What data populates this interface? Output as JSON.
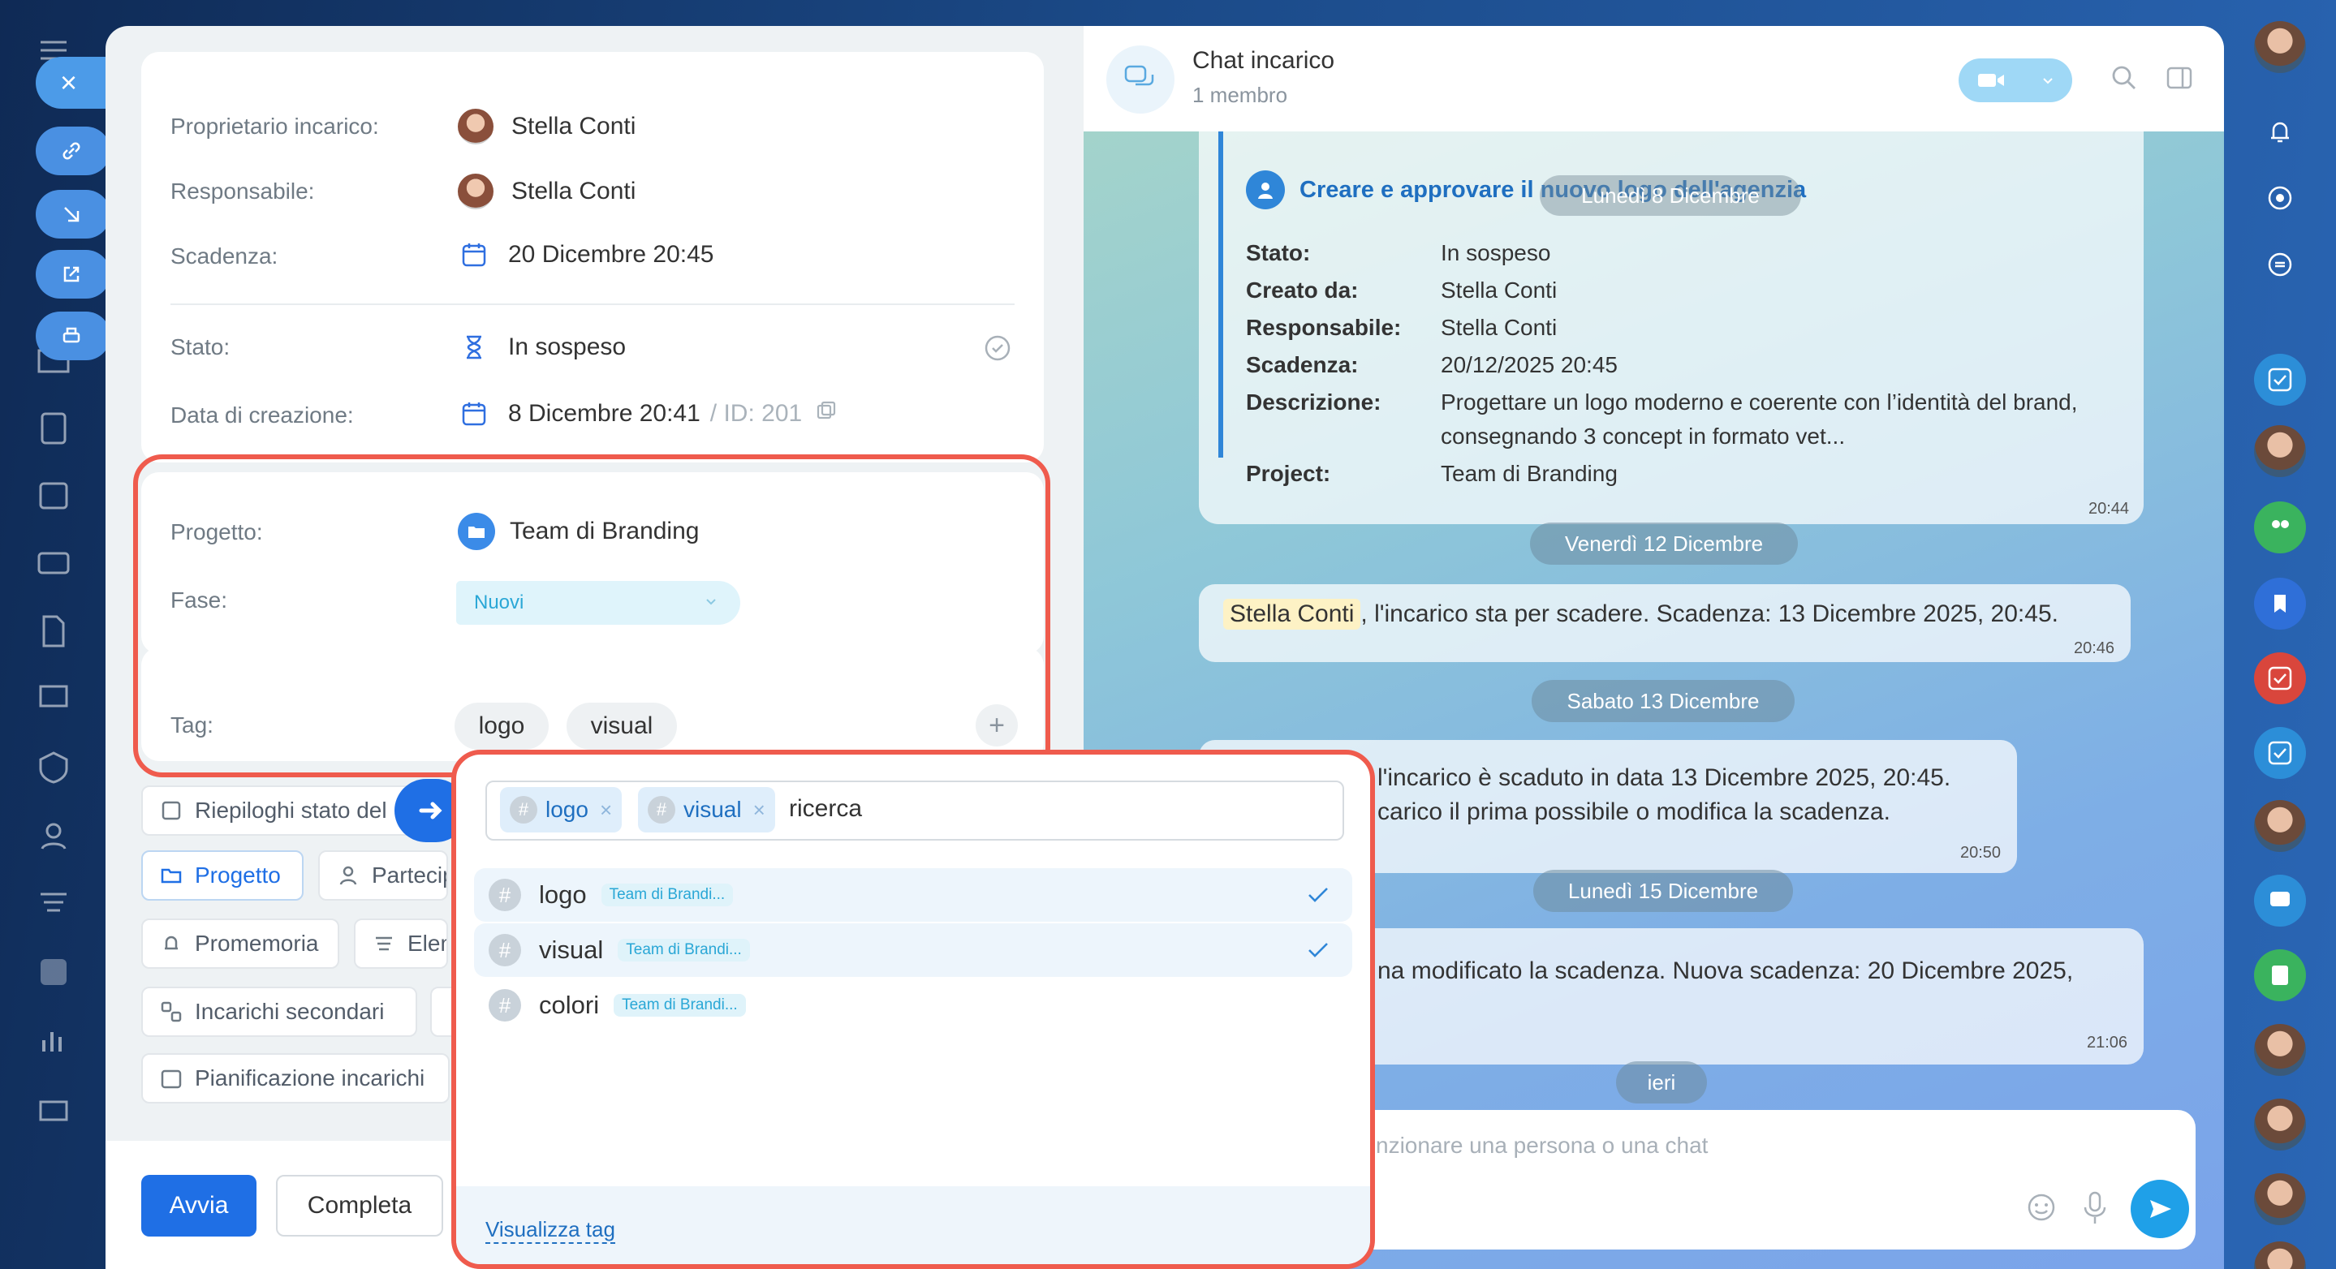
{
  "left_nav": {
    "close_label": "×"
  },
  "task": {
    "fields": {
      "owner_label": "Proprietario incarico:",
      "owner_value": "Stella Conti",
      "assignee_label": "Responsabile:",
      "assignee_value": "Stella Conti",
      "deadline_label": "Scadenza:",
      "deadline_value": "20 Dicembre 20:45",
      "status_label": "Stato:",
      "status_value": "In sospeso",
      "created_label": "Data di creazione:",
      "created_value": "8 Dicembre 20:41",
      "id_value": "/ ID: 201"
    },
    "project": {
      "label": "Progetto:",
      "value": "Team di Branding",
      "stage_label": "Fase:",
      "stage_value": "Nuovi"
    },
    "tags": {
      "label": "Tag:",
      "items": [
        "logo",
        "visual"
      ],
      "add": "+"
    },
    "actions": [
      "Riepiloghi stato del",
      "Progetto",
      "Partecip",
      "Promemoria",
      "Elem",
      "Incarichi secondari",
      "Pianificazione incarichi"
    ],
    "footer": {
      "start": "Avvia",
      "complete": "Completa"
    }
  },
  "tag_popup": {
    "chips": [
      "logo",
      "visual"
    ],
    "search_placeholder": "ricerca",
    "rows": [
      {
        "name": "logo",
        "project": "Team di Brandi...",
        "selected": true
      },
      {
        "name": "visual",
        "project": "Team di Brandi...",
        "selected": true
      },
      {
        "name": "colori",
        "project": "Team di Brandi...",
        "selected": false
      }
    ],
    "footer_link": "Visualizza tag"
  },
  "chat": {
    "title": "Chat incarico",
    "members": "1 membro",
    "card": {
      "title": "Creare e approvare il nuovo logo dell'agenzia",
      "overlap_date": "Lunedì 8 Dicembre",
      "rows": [
        {
          "k": "Stato:",
          "v": "In sospeso"
        },
        {
          "k": "Creato da:",
          "v": "Stella Conti"
        },
        {
          "k": "Responsabile:",
          "v": "Stella Conti"
        },
        {
          "k": "Scadenza:",
          "v": "20/12/2025 20:45"
        },
        {
          "k": "Descrizione:",
          "v": "Progettare un logo moderno e coerente con l’identità del brand,"
        },
        {
          "k": "",
          "v": "consegnando 3 concept in formato vet..."
        },
        {
          "k": "Project:",
          "v": "Team di Branding"
        }
      ],
      "time": "20:44"
    },
    "dates": [
      "Venerdì 12 Dicembre",
      "Sabato 13 Dicembre",
      "Lunedì 15 Dicembre",
      "ieri"
    ],
    "messages": [
      {
        "mention": "Stella Conti",
        "text": ", l'incarico sta per scadere. Scadenza: 13 Dicembre 2025, 20:45.",
        "time": "20:46"
      },
      {
        "line1": "l'incarico è scaduto in data 13 Dicembre 2025, 20:45.",
        "line2": "carico il prima possibile o modifica la scadenza.",
        "time": "20:50"
      },
      {
        "text": "na modificato la scadenza. Nuova scadenza: 20 Dicembre 2025,",
        "time": "21:06"
      }
    ],
    "input_placeholder": "nzionare una persona o una chat"
  },
  "colors": {
    "accent": "#1f6fe5",
    "highlight": "#ef5b4d"
  }
}
